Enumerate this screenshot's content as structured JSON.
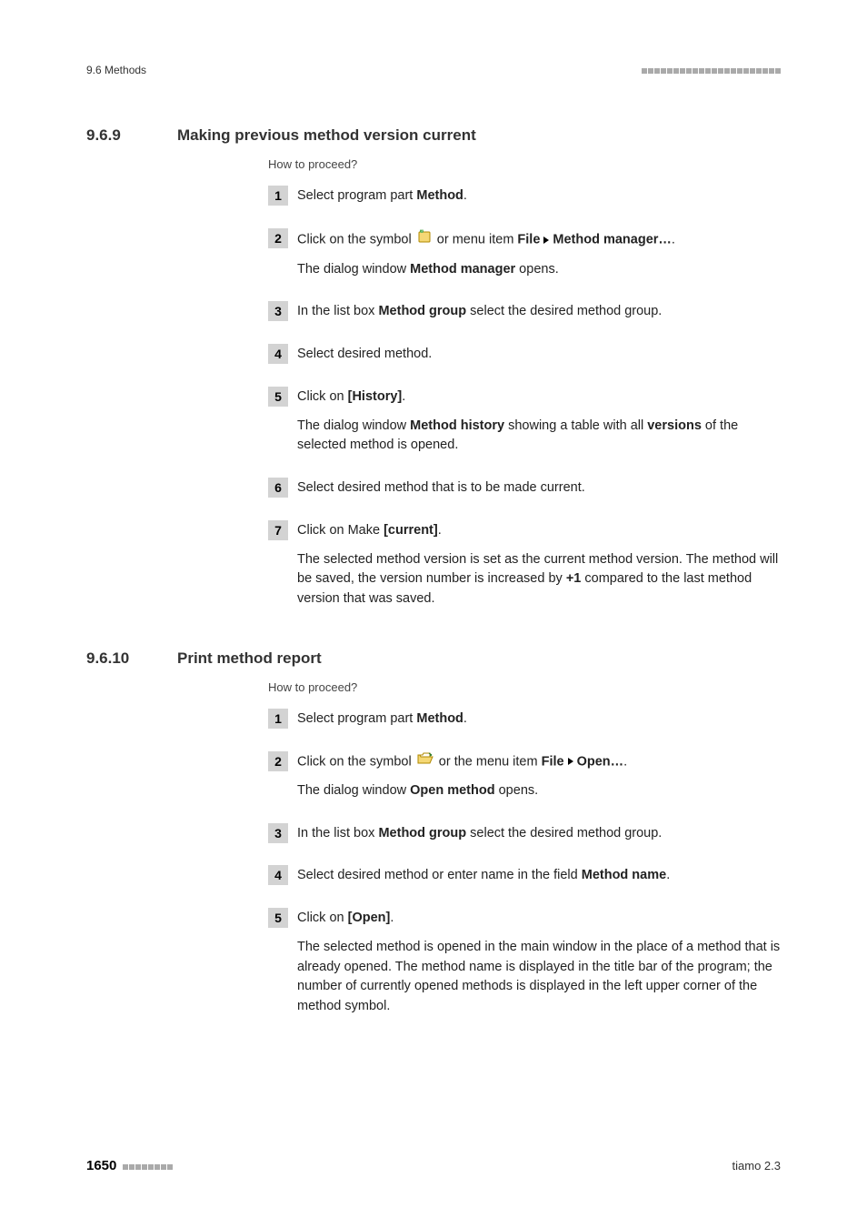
{
  "header": {
    "left": "9.6 Methods"
  },
  "section_969": {
    "number": "9.6.9",
    "title": "Making previous method version current",
    "how_to": "How to proceed?",
    "steps": {
      "s1": {
        "num": "1",
        "p1a": "Select program part ",
        "p1b": "Method",
        "p1c": "."
      },
      "s2": {
        "num": "2",
        "p1a": "Click on the symbol ",
        "p1b": " or menu item ",
        "p1c": "File",
        "p1d": "Method manager…",
        "p1e": ".",
        "p2a": "The dialog window ",
        "p2b": "Method manager",
        "p2c": " opens."
      },
      "s3": {
        "num": "3",
        "p1a": "In the list box ",
        "p1b": "Method group",
        "p1c": " select the desired method group."
      },
      "s4": {
        "num": "4",
        "p1": "Select desired method."
      },
      "s5": {
        "num": "5",
        "p1a": "Click on ",
        "p1b": "[History]",
        "p1c": ".",
        "p2a": "The dialog window ",
        "p2b": "Method history",
        "p2c": " showing a table with all ",
        "p2d": "ver­sions",
        "p2e": " of the selected method is opened."
      },
      "s6": {
        "num": "6",
        "p1": "Select desired method that is to be made current."
      },
      "s7": {
        "num": "7",
        "p1a": "Click on Make ",
        "p1b": "[current]",
        "p1c": ".",
        "p2a": "The selected method version is set as the current method version. The method will be saved, the version number is increased by ",
        "p2b": "+1",
        "p2c": " compared to the last method version that was saved."
      }
    }
  },
  "section_9610": {
    "number": "9.6.10",
    "title": "Print method report",
    "how_to": "How to proceed?",
    "steps": {
      "s1": {
        "num": "1",
        "p1a": "Select program part ",
        "p1b": "Method",
        "p1c": "."
      },
      "s2": {
        "num": "2",
        "p1a": "Click on the symbol ",
        "p1b": " or the menu item ",
        "p1c": "File",
        "p1d": "Open…",
        "p1e": ".",
        "p2a": "The dialog window ",
        "p2b": "Open method",
        "p2c": " opens."
      },
      "s3": {
        "num": "3",
        "p1a": "In the list box ",
        "p1b": "Method group",
        "p1c": " select the desired method group."
      },
      "s4": {
        "num": "4",
        "p1a": "Select desired method or enter name in the field ",
        "p1b": "Method name",
        "p1c": "."
      },
      "s5": {
        "num": "5",
        "p1a": "Click on ",
        "p1b": "[Open]",
        "p1c": ".",
        "p2": "The selected method is opened in the main window in the place of a method that is already opened. The method name is displayed in the title bar of the program; the number of currently opened methods is displayed in the left upper corner of the method symbol."
      }
    }
  },
  "footer": {
    "page": "1650",
    "right": "tiamo 2.3"
  }
}
